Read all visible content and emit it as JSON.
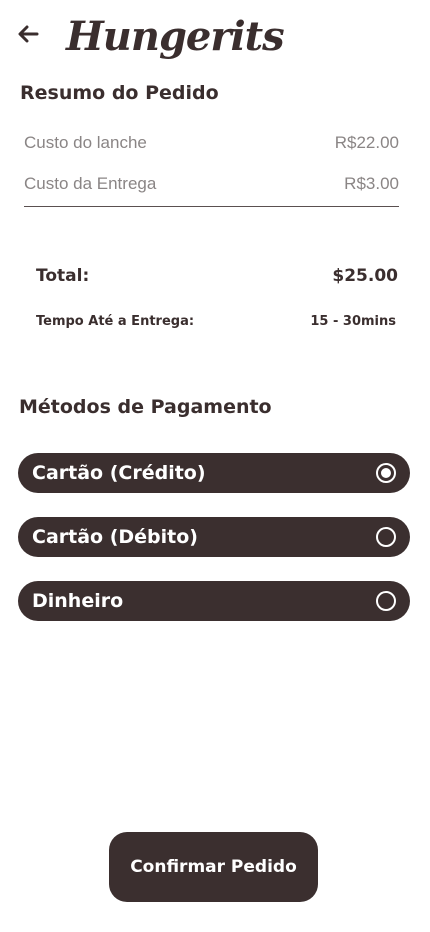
{
  "header": {
    "back_icon": "arrow-left-icon",
    "brand": "Hungerits"
  },
  "summary": {
    "title": "Resumo do Pedido",
    "snack_cost_label": "Custo do lanche",
    "snack_cost_value": "R$22.00",
    "delivery_cost_label": "Custo da Entrega",
    "delivery_cost_value": "R$3.00",
    "total_label": "Total:",
    "total_value": "$25.00",
    "delivery_time_label": "Tempo Até a Entrega:",
    "delivery_time_value": "15 - 30mins"
  },
  "payment": {
    "title": "Métodos de Pagamento",
    "options": [
      {
        "label": "Cartão (Crédito)",
        "selected": true
      },
      {
        "label": "Cartão (Débito)",
        "selected": false
      },
      {
        "label": "Dinheiro",
        "selected": false
      }
    ]
  },
  "actions": {
    "confirm_label": "Confirmar Pedido"
  },
  "colors": {
    "primary": "#3b2f2f",
    "muted_text": "#8a8585",
    "background": "#ffffff"
  }
}
